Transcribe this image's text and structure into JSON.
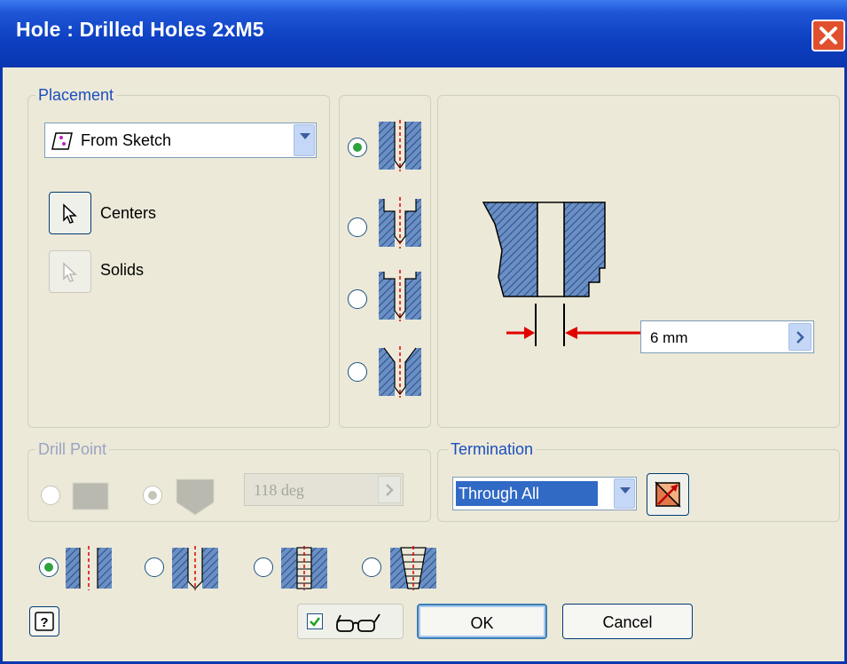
{
  "window": {
    "title": "Hole : Drilled Holes 2xM5"
  },
  "placement": {
    "legend": "Placement",
    "source_value": "From Sketch",
    "centers_label": "Centers",
    "solids_label": "Solids"
  },
  "diameter": {
    "value": "6 mm"
  },
  "drill_point": {
    "legend": "Drill Point",
    "angle_value": "118 deg"
  },
  "termination": {
    "legend": "Termination",
    "value": "Through All"
  },
  "buttons": {
    "ok": "OK",
    "cancel": "Cancel"
  },
  "icons": {
    "close": "close-icon",
    "sketch": "sketch-icon",
    "cursor": "cursor-arrow-icon",
    "flip": "flip-direction-icon",
    "help": "help-icon",
    "preview": "glasses-icon"
  },
  "colors": {
    "title_bar": "#0a36b0",
    "accent_label": "#1b4ebe",
    "hatch": "#5a7fb0",
    "dimension_arrow": "#e00000"
  }
}
